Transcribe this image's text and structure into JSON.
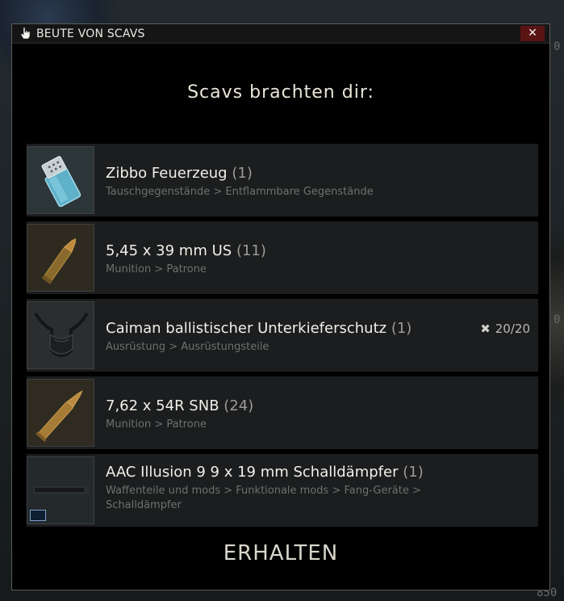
{
  "background": {
    "numbers": [
      "0",
      "0",
      "850"
    ]
  },
  "dialog": {
    "title": "BEUTE VON SCAVS",
    "close_label": "✕",
    "heading": "Scavs brachten dir:",
    "receive_label": "ERHALTEN"
  },
  "items": [
    {
      "name": "Zibbo Feuerzeug",
      "qty": "(1)",
      "category": "Tauschgegenstände > Entflammbare Gegenstände",
      "icon": "lighter-icon"
    },
    {
      "name": "5,45 x 39 mm US",
      "qty": "(11)",
      "category": "Munition > Patrone",
      "icon": "cartridge-icon"
    },
    {
      "name": "Caiman ballistischer Unterkieferschutz",
      "qty": "(1)",
      "durability": "20/20",
      "category": "Ausrüstung > Ausrüstungsteile",
      "icon": "mandible-guard-icon"
    },
    {
      "name": "7,62 x 54R SNB",
      "qty": "(24)",
      "category": "Munition > Patrone",
      "icon": "cartridge-icon"
    },
    {
      "name": "AAC Illusion 9 9 x 19 mm Schalldämpfer",
      "qty": "(1)",
      "category_line1": "Waffenteile und mods > Funktionale mods > Fang-Geräte >",
      "category_line2": "Schalldämpfer",
      "icon": "suppressor-icon"
    }
  ],
  "colors": {
    "dialog_bg": "#000000",
    "row_bg": "#1b1d1e",
    "close_bg": "#5a1414",
    "text_primary": "#f0efe8",
    "text_muted": "#6f7170"
  }
}
